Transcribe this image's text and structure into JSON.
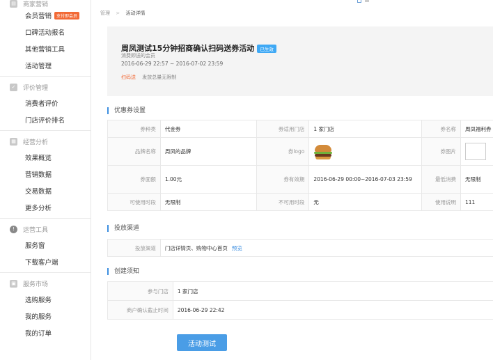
{
  "sidebar": {
    "sections": [
      {
        "title": "商家营销",
        "icon": "store-icon",
        "items": [
          {
            "label": "会员营销",
            "tag": "支付即会员"
          },
          {
            "label": "口碑活动报名"
          },
          {
            "label": "其他营销工具"
          },
          {
            "label": "活动管理"
          }
        ]
      },
      {
        "title": "评价管理",
        "icon": "checkbox-icon",
        "items": [
          {
            "label": "消费者评价"
          },
          {
            "label": "门店评价排名"
          }
        ]
      },
      {
        "title": "经营分析",
        "icon": "chart-icon",
        "items": [
          {
            "label": "效果概览"
          },
          {
            "label": "营销数据"
          },
          {
            "label": "交易数据"
          },
          {
            "label": "更多分析"
          }
        ]
      },
      {
        "title": "运营工具",
        "icon": "info-icon",
        "items": [
          {
            "label": "服务窗"
          },
          {
            "label": "下载客户端"
          }
        ]
      },
      {
        "title": "服务市场",
        "icon": "market-icon",
        "items": [
          {
            "label": "选购服务"
          },
          {
            "label": "我的服务"
          },
          {
            "label": "我的订单"
          }
        ]
      }
    ]
  },
  "breadcrumb": {
    "root": "管理",
    "sep": ">",
    "current": "活动详情"
  },
  "hero": {
    "title": "周凤测试15分钟招商确认扫码送券活动",
    "badge": "已生效",
    "audience": "消费即送的会员",
    "period": "2016-06-29 22:57 ~ 2016-07-02 23:59",
    "type_tag": "扫码送",
    "total": "发放总量无限制"
  },
  "coupon_section": {
    "title": "优惠券设置",
    "rows": [
      [
        {
          "label": "券种类",
          "value": "代金券"
        },
        {
          "label": "券适用门店",
          "value": "1 家门店"
        },
        {
          "label": "券名称",
          "value": "周凤福利券"
        }
      ],
      [
        {
          "label": "品牌名称",
          "value": "周凤的品牌"
        },
        {
          "label": "券logo",
          "value": ""
        },
        {
          "label": "券图片",
          "value": ""
        }
      ],
      [
        {
          "label": "券面额",
          "value": "1.00元"
        },
        {
          "label": "券有效期",
          "value": "2016-06-29 00:00~2016-07-03 23:59"
        },
        {
          "label": "最低消费",
          "value": "无限制"
        }
      ],
      [
        {
          "label": "可使用时段",
          "value": "无限制"
        },
        {
          "label": "不可用时段",
          "value": "无"
        },
        {
          "label": "使用说明",
          "value": "111"
        }
      ]
    ]
  },
  "channel_section": {
    "title": "投放渠道",
    "label": "投放渠道",
    "value": "门店详情页、购物中心首页",
    "preview": "预览"
  },
  "create_section": {
    "title": "创建须知",
    "rows": [
      {
        "label": "参与门店",
        "value": "1 家门店"
      },
      {
        "label": "商户确认截止时间",
        "value": "2016-06-29 22:42"
      }
    ]
  },
  "action": {
    "test_button": "活动测试"
  }
}
